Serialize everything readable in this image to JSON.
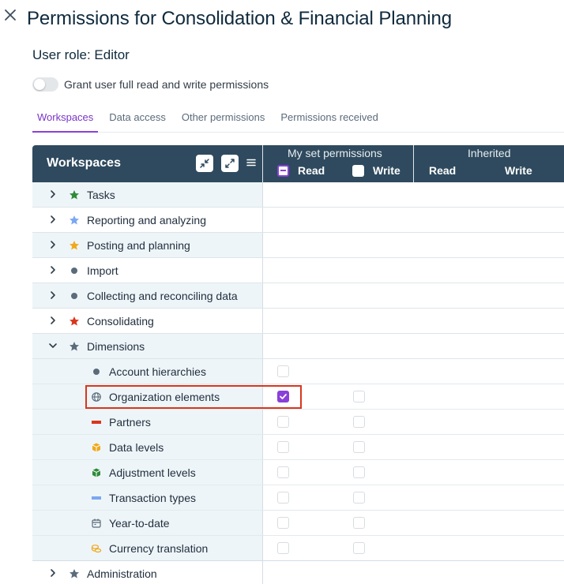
{
  "dialog": {
    "title": "Permissions for Consolidation & Financial Planning",
    "role_line": "User role: Editor",
    "toggle_label": "Grant user full read and write permissions",
    "toggle_on": false
  },
  "tabs": [
    {
      "label": "Workspaces",
      "active": true
    },
    {
      "label": "Data access",
      "active": false
    },
    {
      "label": "Other permissions",
      "active": false
    },
    {
      "label": "Permissions received",
      "active": false
    }
  ],
  "grid": {
    "header_title": "Workspaces",
    "my_set_label": "My set permissions",
    "inherited_label": "Inherited",
    "read_label": "Read",
    "write_label": "Write",
    "inherited_read_label": "Read",
    "inherited_write_label": "Write",
    "header_read_state": "indeterminate",
    "header_write_state": "unchecked"
  },
  "rows": [
    {
      "label": "Tasks",
      "icon": "star-icon",
      "color": "#2e8b3a",
      "expanded": false
    },
    {
      "label": "Reporting and analyzing",
      "icon": "star-icon",
      "color": "#7aa7f0",
      "expanded": false
    },
    {
      "label": "Posting and planning",
      "icon": "star-icon",
      "color": "#f0a81c",
      "expanded": false
    },
    {
      "label": "Import",
      "icon": "dot-icon",
      "color": "#5a6b7b",
      "expanded": false
    },
    {
      "label": "Collecting and reconciling data",
      "icon": "dot-icon",
      "color": "#5a6b7b",
      "expanded": false
    },
    {
      "label": "Consolidating",
      "icon": "star-icon",
      "color": "#d9361e",
      "expanded": false
    },
    {
      "label": "Dimensions",
      "icon": "star-icon",
      "color": "#5a6b7b",
      "expanded": true,
      "children": [
        {
          "label": "Account hierarchies",
          "icon": "dot-icon",
          "color": "#5a6b7b",
          "read": false,
          "write": null
        },
        {
          "label": "Organization elements",
          "icon": "globe-icon",
          "color": "#5a6b7b",
          "read": true,
          "write": false,
          "highlighted": true
        },
        {
          "label": "Partners",
          "icon": "bar-icon",
          "color": "#d9361e",
          "read": false,
          "write": false
        },
        {
          "label": "Data levels",
          "icon": "cube-icon",
          "color": "#f0a81c",
          "read": false,
          "write": false
        },
        {
          "label": "Adjustment levels",
          "icon": "cube-icon",
          "color": "#2e8b3a",
          "read": false,
          "write": false
        },
        {
          "label": "Transaction types",
          "icon": "bar-icon",
          "color": "#7aa7f0",
          "read": false,
          "write": false
        },
        {
          "label": "Year-to-date",
          "icon": "calendar-icon",
          "color": "#5a6b7b",
          "read": false,
          "write": false
        },
        {
          "label": "Currency translation",
          "icon": "coins-icon",
          "color": "#f0a81c",
          "read": false,
          "write": false
        }
      ]
    },
    {
      "label": "Administration",
      "icon": "star-icon",
      "color": "#5a6b7b",
      "expanded": false
    }
  ]
}
